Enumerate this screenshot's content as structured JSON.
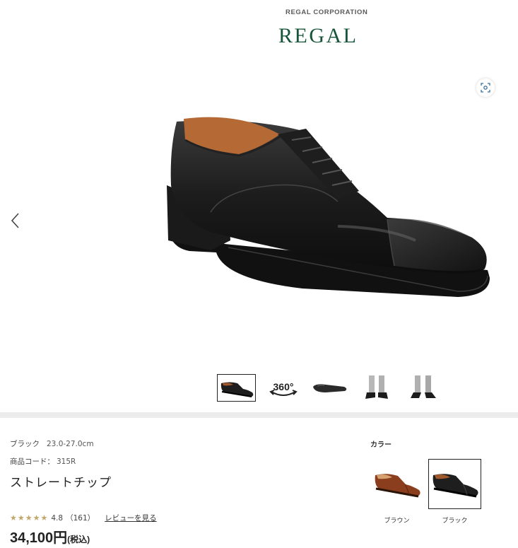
{
  "brand": {
    "corporation": "REGAL CORPORATION",
    "logo": "REGAL"
  },
  "gallery": {
    "zoom_icon": "zoom-icon",
    "prev_icon": "chevron-left-icon",
    "thumbnails": [
      {
        "label": "side-view",
        "active": true
      },
      {
        "label": "360",
        "active": false
      },
      {
        "label": "sole-view",
        "active": false
      },
      {
        "label": "worn-front",
        "active": false
      },
      {
        "label": "worn-side",
        "active": false
      }
    ],
    "thumb_360_text": "360°"
  },
  "product": {
    "color": "ブラック",
    "size_range": "23.0-27.0cm",
    "code_label": "商品コード：",
    "code": "315R",
    "name": "ストレートチップ",
    "rating": "4.8",
    "review_count": "（161）",
    "review_link": "レビューを見る",
    "price": "34,100円",
    "tax_label": "(税込)"
  },
  "colors": {
    "heading": "カラー",
    "options": [
      {
        "label": "ブラウン",
        "selected": false,
        "swatch": "#8b3e1d"
      },
      {
        "label": "ブラック",
        "selected": true,
        "swatch": "#1e1e1e"
      }
    ]
  },
  "theme": {
    "brand_green": "#17553a",
    "star_gold": "#c3a66a"
  }
}
